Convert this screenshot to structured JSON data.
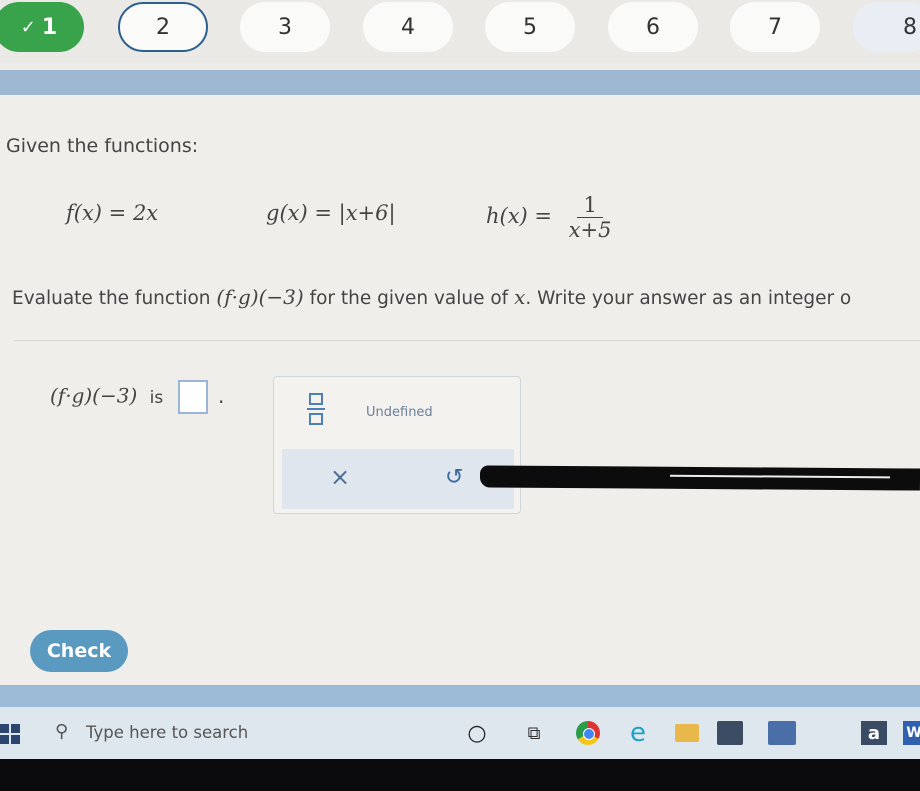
{
  "steps": [
    {
      "label": "1",
      "state": "done",
      "check": "✓"
    },
    {
      "label": "2",
      "state": "current"
    },
    {
      "label": "3",
      "state": "todo"
    },
    {
      "label": "4",
      "state": "todo"
    },
    {
      "label": "5",
      "state": "todo"
    },
    {
      "label": "6",
      "state": "todo"
    },
    {
      "label": "7",
      "state": "todo"
    },
    {
      "label": "8",
      "state": "todo"
    }
  ],
  "question": {
    "intro": "Given the functions:",
    "f": "f(x) = 2x",
    "g": "g(x) = |x+6|",
    "h_lhs": "h(x) =",
    "h_num": "1",
    "h_den": "x+5",
    "prompt_pre": "Evaluate the function",
    "prompt_expr": "(f·g)(−3)",
    "prompt_post": "for the given value of",
    "prompt_var": "x",
    "prompt_end": ". Write your answer as an integer o"
  },
  "answer": {
    "expr": "(f·g)(−3)",
    "is": "is",
    "period": "."
  },
  "keypad": {
    "undefined_label": "Undefined",
    "clear_symbol": "×",
    "undo_symbol": "↺"
  },
  "check_label": "Check",
  "taskbar": {
    "search_placeholder": "Type here to search",
    "amazon_letter": "a",
    "word_letter": "W"
  },
  "colors": {
    "done_step": "#38a34a",
    "current_step_border": "#2b5f8e",
    "accent_bar": "#9fb8d2",
    "check_button": "#5b9ac0"
  }
}
